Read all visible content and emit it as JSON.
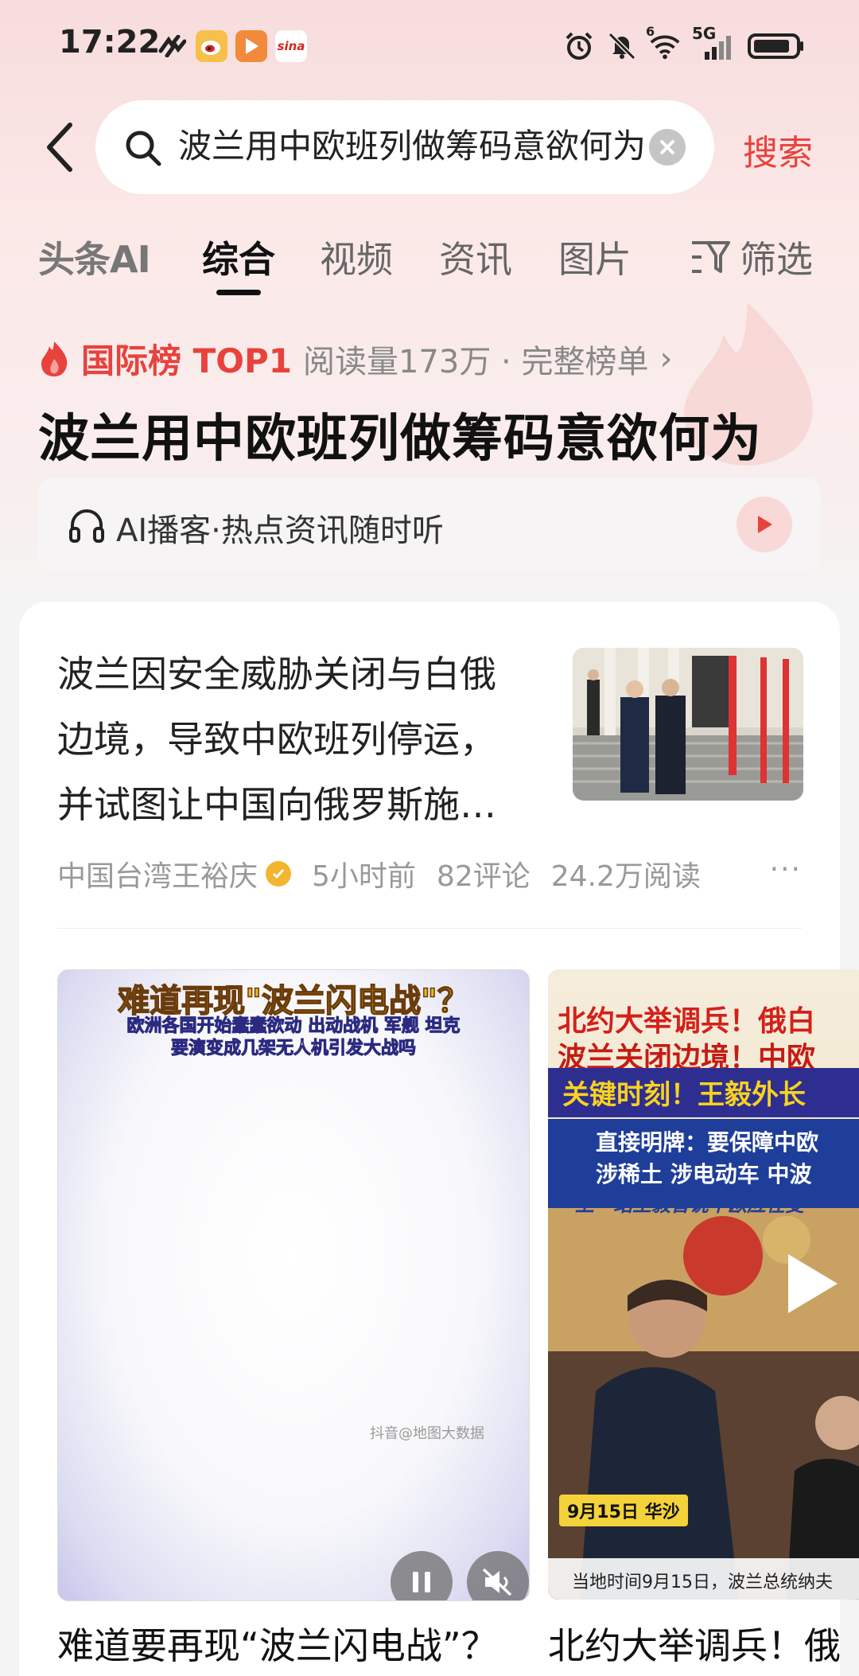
{
  "status_bar": {
    "time": "17:22",
    "app_icons": [
      "link-icon",
      "weibo-icon",
      "video-app-icon",
      "sina-icon"
    ],
    "sina_label": "sina",
    "network_label": "5G",
    "wifi_label": "6",
    "right_icons": [
      "alarm-icon",
      "mute-bell-icon",
      "wifi-icon",
      "signal-icon",
      "battery-icon"
    ]
  },
  "search": {
    "query": "波兰用中欧班列做筹码意欲何为",
    "button_label": "搜索"
  },
  "tabs": {
    "items": [
      "头条AI",
      "综合",
      "视频",
      "资讯",
      "图片"
    ],
    "active_index": 1,
    "filter_label": "筛选"
  },
  "hot_rank": {
    "label": "国际榜 TOP1",
    "meta": "阅读量173万 · 完整榜单",
    "title": "波兰用中欧班列做筹码意欲何为"
  },
  "podcast": {
    "label": "AI播客·热点资讯随时听"
  },
  "article": {
    "lines": [
      "波兰因安全威胁关闭与白俄",
      "边境，导致中欧班列停运，",
      "并试图让中国向俄罗斯施…"
    ],
    "author": "中国台湾王裕庆",
    "time": "5小时前",
    "comments": "82评论",
    "reads": "24.2万阅读",
    "more": "···"
  },
  "video1": {
    "overlay_title": "难道再现\"波兰闪电战\"？",
    "overlay_sub1": "欧洲各国开始蠢蠢欲动 出动战机 军舰 坦克",
    "overlay_sub2": "要演变成几架无人机引发大战吗",
    "watermark": "抖音@地图大数据",
    "caption": "难道要再现“波兰闪电战”？"
  },
  "video2": {
    "line1": "北约大举调兵！俄白",
    "line2": "波兰关闭边境！中欧",
    "line3": "关键时刻！王毅外长",
    "blue1": "直接明牌：要保障中欧",
    "blue2": "涉稀土 涉电动车 中波",
    "subcaption": "上一站王毅曾说中欧应在变",
    "date": "9月15日 华沙",
    "bottom_text": "当地时间9月15日，波兰总统纳夫",
    "caption": "北约大举调兵！俄"
  },
  "colors": {
    "accent": "#e8423d",
    "background_top": "#f7dcdc",
    "text_primary": "#111111",
    "text_secondary": "#999999"
  }
}
